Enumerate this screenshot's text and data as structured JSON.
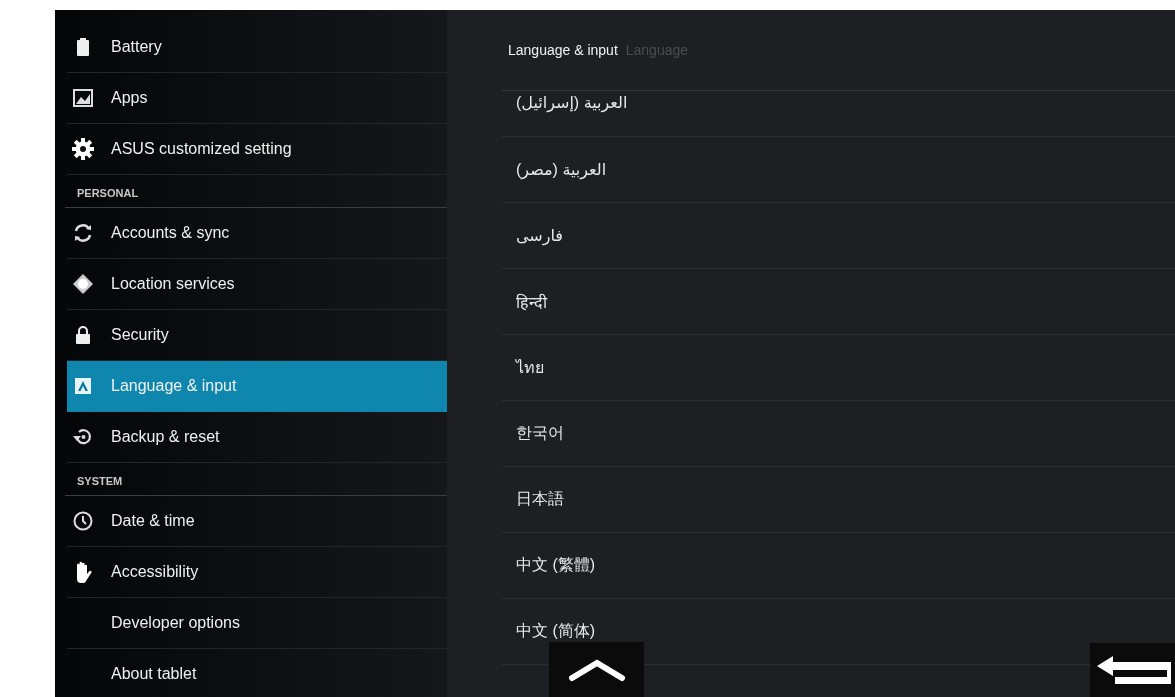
{
  "sidebar": {
    "items": [
      {
        "kind": "item",
        "label": "Battery",
        "selected": false
      },
      {
        "kind": "item",
        "label": "Apps",
        "selected": false
      },
      {
        "kind": "item",
        "label": "ASUS customized setting",
        "selected": false
      },
      {
        "kind": "header",
        "label": "PERSONAL"
      },
      {
        "kind": "item",
        "label": "Accounts & sync",
        "selected": false
      },
      {
        "kind": "item",
        "label": "Location services",
        "selected": false
      },
      {
        "kind": "item",
        "label": "Security",
        "selected": false
      },
      {
        "kind": "item",
        "label": "Language & input",
        "selected": true
      },
      {
        "kind": "item",
        "label": "Backup & reset",
        "selected": false
      },
      {
        "kind": "header",
        "label": "SYSTEM"
      },
      {
        "kind": "item",
        "label": "Date & time",
        "selected": false
      },
      {
        "kind": "item",
        "label": "Accessibility",
        "selected": false
      },
      {
        "kind": "item",
        "label": "Developer options",
        "selected": false
      },
      {
        "kind": "item",
        "label": "About tablet",
        "selected": false
      }
    ]
  },
  "breadcrumb": {
    "title": "Language & input",
    "subtitle": "Language"
  },
  "languages": [
    "العربية (إسرائيل)",
    "العربية (مصر)",
    "فارسی",
    "हिन्दी",
    "ไทย",
    "한국어",
    "日本語",
    "中文 (繁體)",
    "中文 (简体)"
  ]
}
